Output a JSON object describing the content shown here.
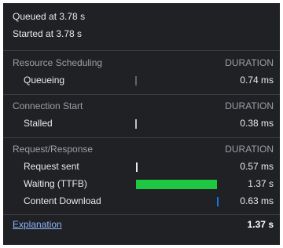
{
  "header": {
    "queued": "Queued at 3.78 s",
    "started": "Started at 3.78 s"
  },
  "sections": [
    {
      "title": "Resource Scheduling",
      "duration_label": "DURATION",
      "rows": [
        {
          "label": "Queueing",
          "value": "0.74 ms",
          "bar_color": "#5f6368"
        }
      ]
    },
    {
      "title": "Connection Start",
      "duration_label": "DURATION",
      "rows": [
        {
          "label": "Stalled",
          "value": "0.38 ms",
          "bar_color": "#bdc1c6"
        }
      ]
    },
    {
      "title": "Request/Response",
      "duration_label": "DURATION",
      "rows": [
        {
          "label": "Request sent",
          "value": "0.57 ms",
          "bar_color": "#e8eaed"
        },
        {
          "label": "Waiting (TTFB)",
          "value": "1.37 s",
          "bar_color": "#1ec843"
        },
        {
          "label": "Content Download",
          "value": "0.63 ms",
          "bar_color": "#1a73e8"
        }
      ]
    }
  ],
  "footer": {
    "link": "Explanation",
    "total": "1.37 s"
  },
  "colors": {
    "background": "#202124",
    "link": "#8ab4f8",
    "ttfb": "#1ec843",
    "download": "#1a73e8"
  }
}
